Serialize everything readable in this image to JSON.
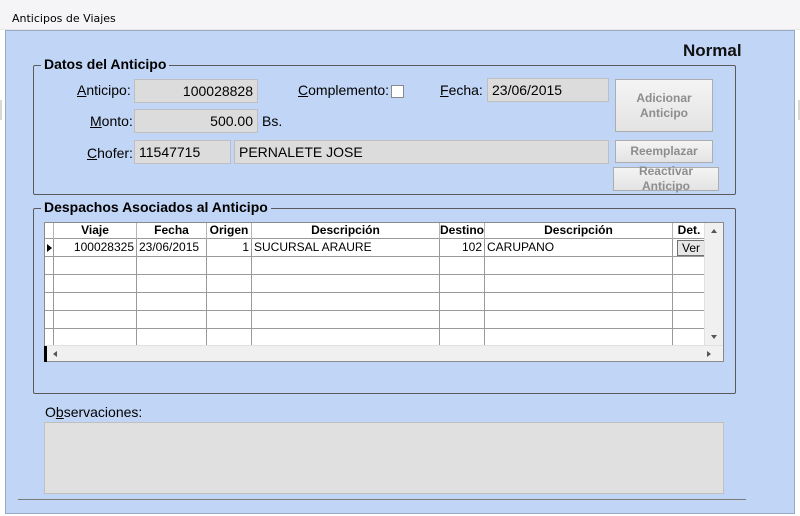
{
  "window": {
    "title": "Anticipos de Viajes"
  },
  "mode_label": "Normal",
  "datos": {
    "legend": "Datos del Anticipo",
    "anticipo_label_u": "A",
    "anticipo_label_rest": "nticipo:",
    "anticipo_value": "100028828",
    "complemento_label_u": "C",
    "complemento_label_rest": "omplemento:",
    "complemento_checked": false,
    "fecha_label_u": "F",
    "fecha_label_rest": "echa:",
    "fecha_value": "23/06/2015",
    "monto_label_u": "M",
    "monto_label_rest": "onto:",
    "monto_value": "500.00",
    "monto_unit": "Bs.",
    "chofer_label_u": "C",
    "chofer_label_rest": "hofer:",
    "chofer_id": "11547715",
    "chofer_name": "PERNALETE JOSE"
  },
  "buttons": {
    "adicionar_line1": "Adicionar",
    "adicionar_line2": "Anticipo",
    "reemplazar": "Reemplazar",
    "reactivar": "Reactivar Anticipo"
  },
  "despachos": {
    "legend": "Despachos Asociados al Anticipo",
    "columns": [
      "Viaje",
      "Fecha",
      "Origen",
      "Descripción",
      "Destino",
      "Descripción",
      "Det."
    ],
    "rows": [
      {
        "viaje": "100028325",
        "fecha": "23/06/2015",
        "origen": "1",
        "origen_desc": "SUCURSAL ARAURE",
        "destino": "102",
        "destino_desc": "CARUPANO",
        "det": "Ver"
      }
    ]
  },
  "observaciones": {
    "label_pre": "O",
    "label_u": "b",
    "label_rest": "servaciones:",
    "value": ""
  }
}
